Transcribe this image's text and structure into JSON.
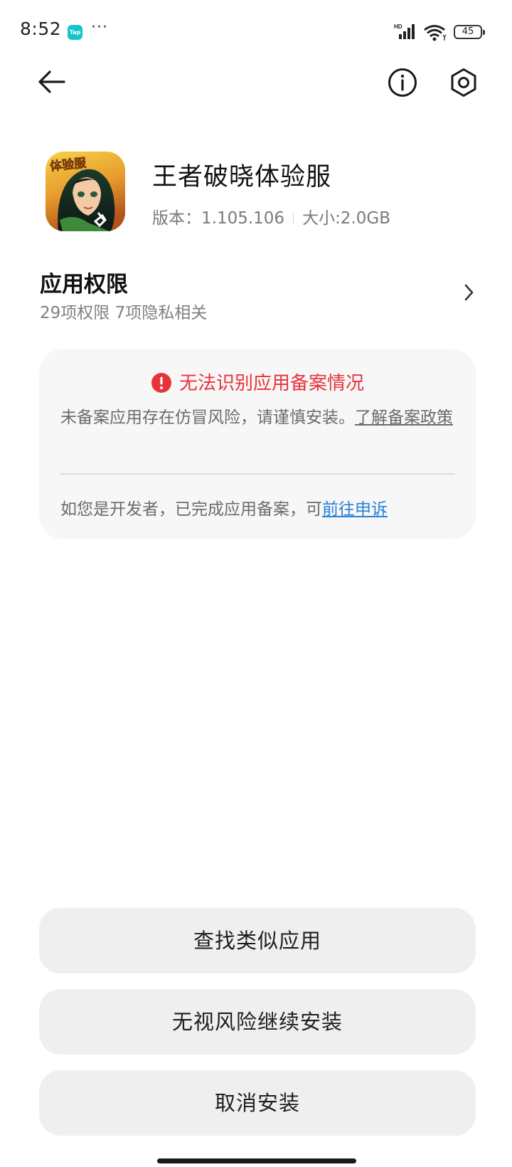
{
  "status_bar": {
    "time": "8:52",
    "tap_badge": "Tap",
    "more": "···",
    "network_label": "HD",
    "battery": "45"
  },
  "nav": {
    "back_icon": "arrow-left-icon",
    "info_icon": "info-icon",
    "settings_icon": "hexagon-settings-icon"
  },
  "app": {
    "name": "王者破晓体验服",
    "icon_badge_text": "体验服",
    "version_label": "版本：1.105.106",
    "size_label": "大小:2.0GB"
  },
  "permissions": {
    "title": "应用权限",
    "subtitle": "29项权限 7项隐私相关"
  },
  "warning": {
    "title": "无法识别应用备案情况",
    "body_prefix": "未备案应用存在仿冒风险，请谨慎安装。",
    "body_link": "了解备案政策",
    "developer_prefix": "如您是开发者，已完成应用备案，可",
    "developer_link": "前往申诉",
    "accent_color": "#e7333a",
    "link_color": "#2a80d8"
  },
  "buttons": {
    "find_similar": "查找类似应用",
    "ignore_risk": "无视风险继续安装",
    "cancel_install": "取消安装"
  }
}
